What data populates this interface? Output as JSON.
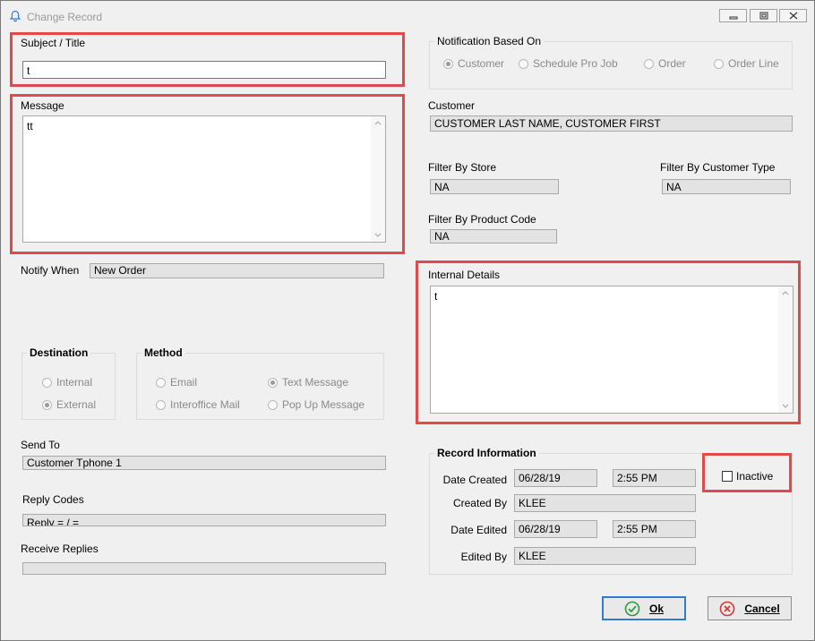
{
  "window": {
    "title": "Change Record"
  },
  "subject": {
    "label": "Subject / Title",
    "value": "t"
  },
  "message": {
    "label": "Message",
    "value": "tt"
  },
  "notify_when": {
    "label": "Notify When",
    "value": "New Order"
  },
  "destination": {
    "title": "Destination",
    "options": [
      "Internal",
      "External"
    ],
    "selected": "External"
  },
  "method": {
    "title": "Method",
    "options": [
      "Email",
      "Text Message",
      "Interoffice Mail",
      "Pop Up Message"
    ],
    "selected": "Text Message"
  },
  "send_to": {
    "label": "Send To",
    "value": "Customer Tphone 1"
  },
  "reply_codes": {
    "label": "Reply Codes",
    "value": "Reply  =  /  ="
  },
  "receive_replies": {
    "label": "Receive Replies",
    "value": ""
  },
  "notification_based_on": {
    "title": "Notification Based On",
    "options": [
      "Customer",
      "Schedule Pro Job",
      "Order",
      "Order Line"
    ],
    "selected": "Customer"
  },
  "customer": {
    "label": "Customer",
    "value": "CUSTOMER LAST NAME, CUSTOMER FIRST"
  },
  "filter_store": {
    "label": "Filter By Store",
    "value": "NA"
  },
  "filter_customer_type": {
    "label": "Filter By Customer Type",
    "value": "NA"
  },
  "filter_product_code": {
    "label": "Filter By Product Code",
    "value": "NA"
  },
  "internal_details": {
    "label": "Internal Details",
    "value": "t"
  },
  "record_info": {
    "title": "Record Information",
    "date_created_label": "Date Created",
    "date_created": "06/28/19",
    "time_created": "2:55 PM",
    "created_by_label": "Created By",
    "created_by": "KLEE",
    "date_edited_label": "Date Edited",
    "date_edited": "06/28/19",
    "time_edited": "2:55 PM",
    "edited_by_label": "Edited By",
    "edited_by": "KLEE"
  },
  "inactive": {
    "label": "Inactive",
    "checked": false
  },
  "buttons": {
    "ok": "Ok",
    "cancel": "Cancel"
  },
  "colors": {
    "highlight": "#e24a4a",
    "ok_border": "#2e7bd0",
    "ok_icon": "#2e9a3e",
    "cancel_icon": "#d23a3a"
  }
}
